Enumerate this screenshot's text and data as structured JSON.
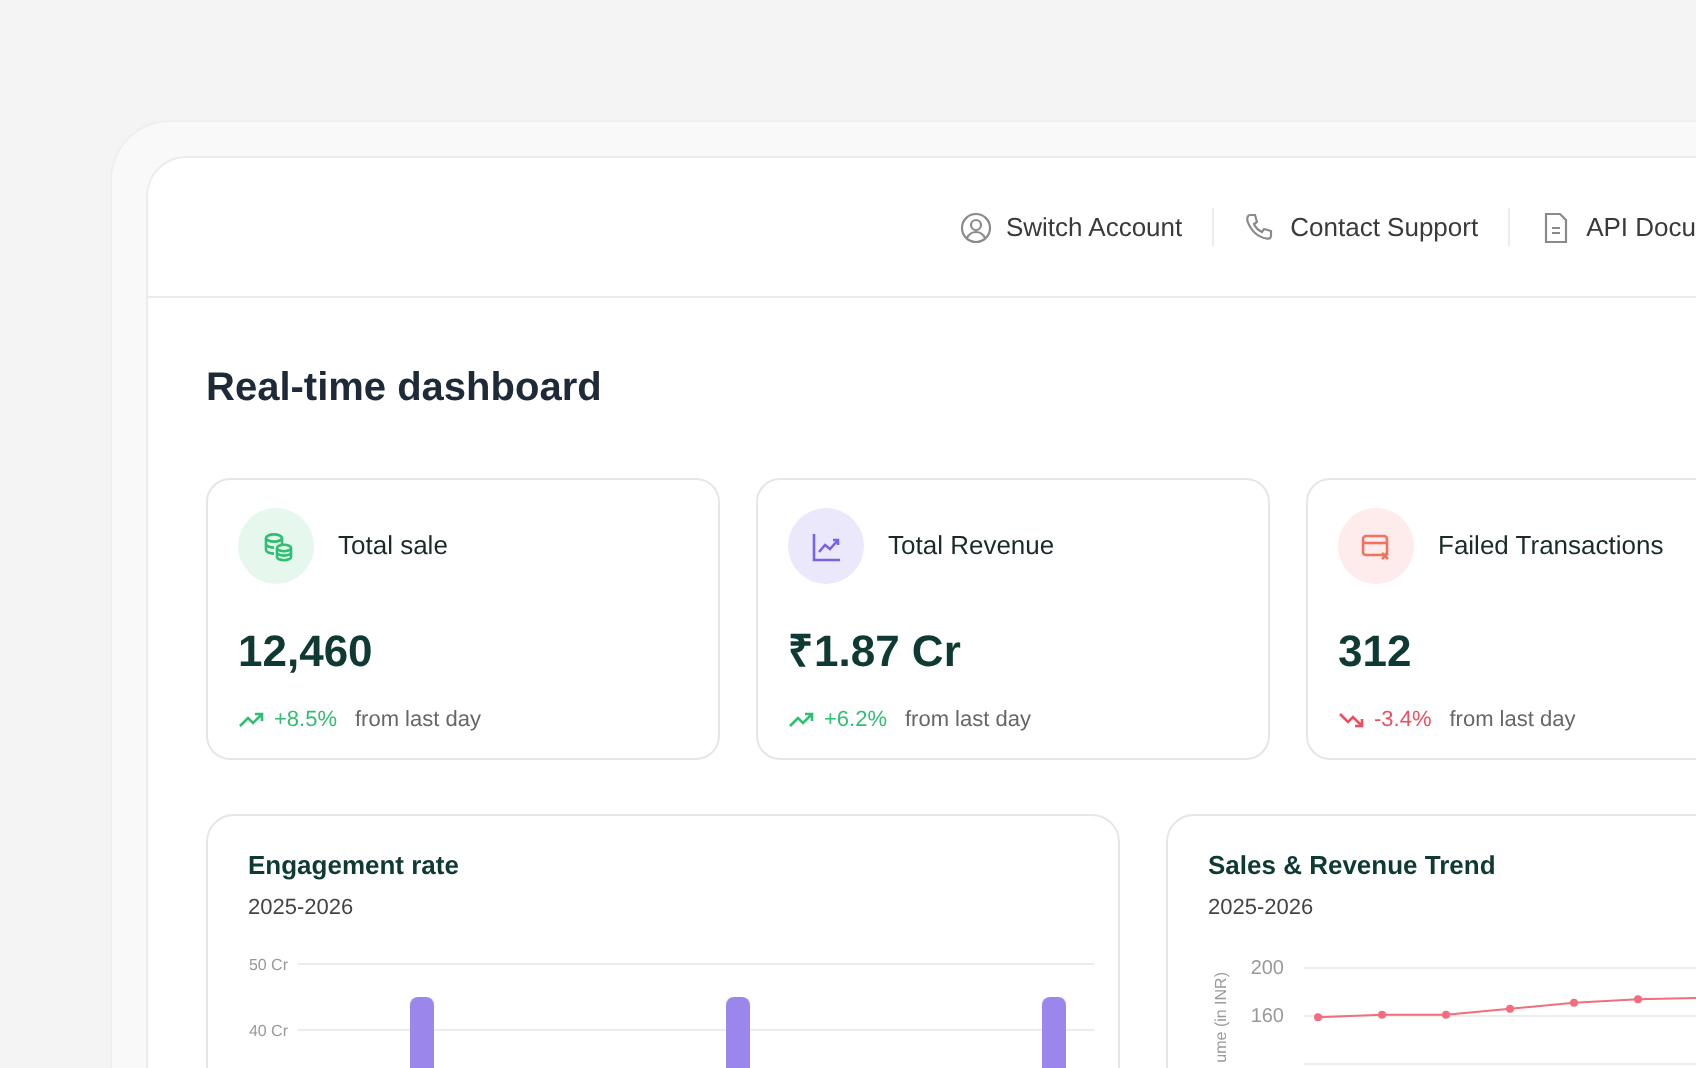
{
  "header": {
    "links": [
      {
        "label": "Switch Account",
        "kind": "user"
      },
      {
        "label": "Contact Support",
        "kind": "phone"
      },
      {
        "label": "API Docu",
        "kind": "doc"
      }
    ]
  },
  "page_title": "Real-time dashboard",
  "stats": [
    {
      "title": "Total sale",
      "value": "12,460",
      "change": {
        "text": "+8.5%",
        "kind": "up"
      },
      "note": "from last day",
      "kind": "coins"
    },
    {
      "title": "Total Revenue",
      "value": "₹1.87 Cr",
      "change": {
        "text": "+6.2%",
        "kind": "up"
      },
      "note": "from last day",
      "kind": "chart"
    },
    {
      "title": "Failed Transactions",
      "value": "312",
      "change": {
        "text": "-3.4%",
        "kind": "down"
      },
      "note": "from last day",
      "kind": "card"
    }
  ],
  "charts": [
    {
      "title": "Engagement rate",
      "subtitle": "2025-2026",
      "chart_data": {
        "type": "bar",
        "ylim": [
          31.2,
          50
        ],
        "yticks": [
          {
            "value": 40,
            "label": "40 Cr"
          },
          {
            "value": 50,
            "label": "50 Cr"
          }
        ],
        "series": [
          {
            "color": "#9b87eb",
            "values": [
              45,
              45,
              45
            ]
          }
        ]
      }
    },
    {
      "title": "Sales & Revenue Trend",
      "subtitle": "2025-2026",
      "chart_data": {
        "type": "line",
        "ylabel": "ume (in INR)",
        "ylim": [
          120,
          200
        ],
        "yticks": [
          160,
          200
        ],
        "series": [
          {
            "color": "#f26d7d",
            "marker": "circle",
            "values": [
              159,
              161,
              161,
              166,
              171,
              174,
              175
            ]
          }
        ]
      }
    }
  ]
}
